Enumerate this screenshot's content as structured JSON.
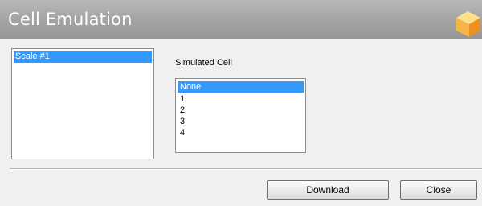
{
  "window": {
    "title": "Cell Emulation"
  },
  "scales": {
    "items": [
      "Scale #1"
    ],
    "selected_index": 0
  },
  "simulated_cell": {
    "label": "Simulated Cell",
    "options": [
      "None",
      "1",
      "2",
      "3",
      "4"
    ],
    "selected_index": 0
  },
  "buttons": {
    "download_label": "Download",
    "close_label": "Close"
  },
  "colors": {
    "selection": "#3399ff",
    "titlebar": "#a6a6a6",
    "cube_top": "#ffd86b",
    "cube_side": "#f39a2b"
  },
  "icons": {
    "app_logo": "cube-icon"
  }
}
